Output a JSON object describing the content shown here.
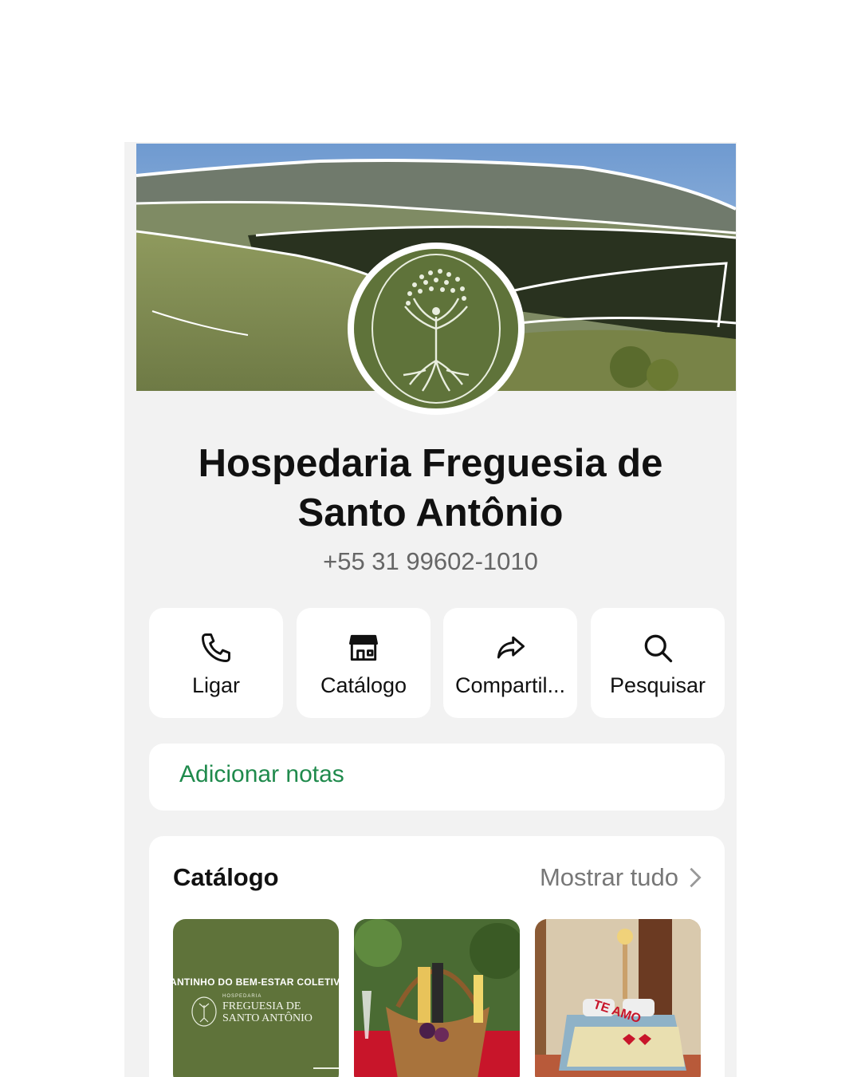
{
  "business": {
    "name_line1": "Hospedaria Freguesia de",
    "name_line2": "Santo Antônio",
    "phone": "+55 31 99602-1010"
  },
  "actions": [
    {
      "label": "Ligar",
      "icon": "phone-icon"
    },
    {
      "label": "Catálogo",
      "icon": "storefront-icon"
    },
    {
      "label": "Compartil...",
      "icon": "share-arrow-icon"
    },
    {
      "label": "Pesquisar",
      "icon": "search-icon"
    }
  ],
  "notes": {
    "label": "Adicionar notas"
  },
  "catalog": {
    "title": "Catálogo",
    "show_all": "Mostrar tudo",
    "items": [
      {
        "banner": "ANTINHO DO BEM-ESTAR COLETIVO",
        "small": "HOSPEDARIA",
        "brand1": "FREGUESIA DE",
        "brand2": "SANTO ANTÔNIO"
      },
      {
        "kind": "gift-basket-photo"
      },
      {
        "kind": "bedroom-photo",
        "text": "TE AMO"
      }
    ]
  },
  "colors": {
    "accent_green": "#1f8a4c",
    "logo_green": "#5f733a"
  }
}
